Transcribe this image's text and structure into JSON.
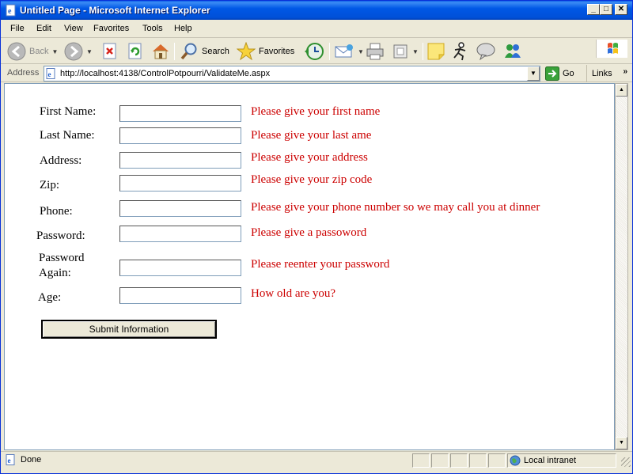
{
  "window": {
    "title": "Untitled Page - Microsoft Internet Explorer",
    "min_glyph": "_",
    "max_glyph": "□",
    "close_glyph": "✕"
  },
  "menu": [
    {
      "label": "File"
    },
    {
      "label": "Edit"
    },
    {
      "label": "View"
    },
    {
      "label": "Favorites"
    },
    {
      "label": "Tools"
    },
    {
      "label": "Help"
    }
  ],
  "toolbar": {
    "back_label": "Back",
    "search_label": "Search",
    "favorites_label": "Favorites"
  },
  "address": {
    "label": "Address",
    "url": "http://localhost:4138/ControlPotpourri/ValidateMe.aspx",
    "go_label": "Go",
    "links_label": "Links",
    "links_chevron": "»"
  },
  "form": {
    "fields": [
      {
        "label": "First Name:",
        "value": "",
        "message": "Please give your first name"
      },
      {
        "label": "Last Name:",
        "value": "",
        "message": "Please give your last ame"
      },
      {
        "label": "Address:",
        "value": "",
        "message": "Please give your address"
      },
      {
        "label": "Zip:",
        "value": "",
        "message": "Please give your zip code"
      },
      {
        "label": "Phone:",
        "value": "",
        "message": "Please give your phone number so we may call you at dinner"
      },
      {
        "label": "Password:",
        "value": "",
        "message": "Please give a passoword"
      },
      {
        "label_line1": "Password",
        "label_line2": "Again:",
        "value": "",
        "message": "Please reenter your password"
      },
      {
        "label": "Age:",
        "value": "",
        "message": "How old are you?"
      }
    ],
    "submit_label": "Submit Information"
  },
  "status": {
    "text": "Done",
    "zone": "Local intranet"
  },
  "colors": {
    "titlebar": "#0058e6",
    "validation_text": "#cc0000",
    "chrome": "#ece9d8"
  }
}
